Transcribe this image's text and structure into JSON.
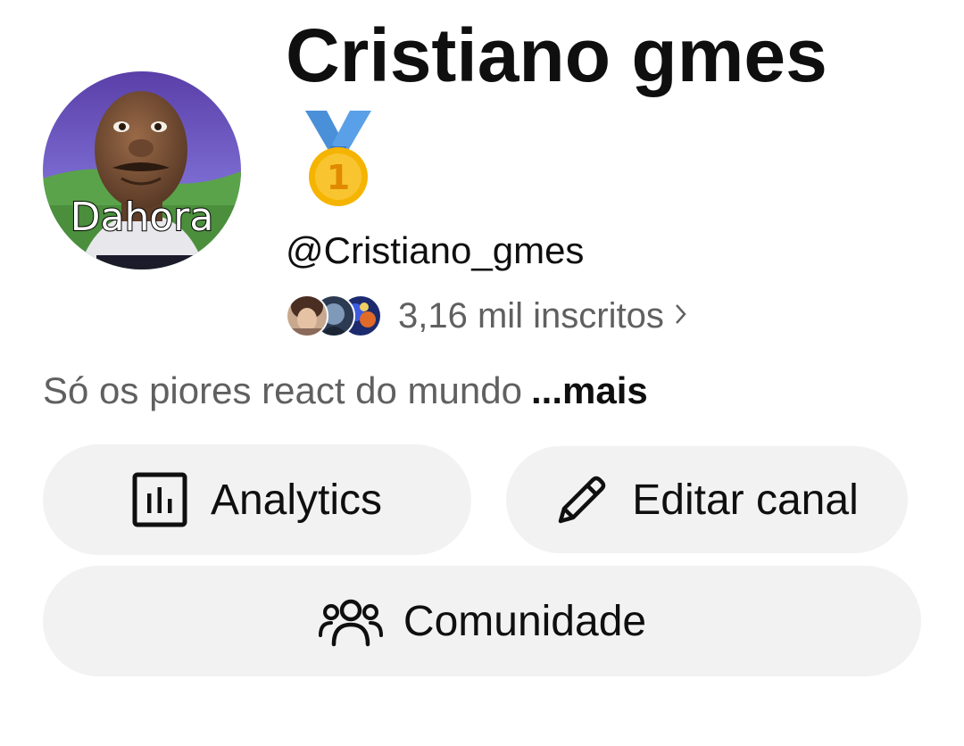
{
  "channel": {
    "name": "Cristiano gmes",
    "handle": "@Cristiano_gmes",
    "avatar_caption": "Dahora",
    "badge_icon": "first-place-medal-icon",
    "subscribers": "3,16 mil inscritos",
    "description": "Só os piores react do mundo",
    "more_label": "...mais"
  },
  "actions": {
    "analytics_label": "Analytics",
    "analytics_icon": "analytics-chart-icon",
    "edit_label": "Editar canal",
    "edit_icon": "pencil-icon",
    "community_label": "Comunidade",
    "community_icon": "people-group-icon"
  },
  "colors": {
    "text_primary": "#0f0f0f",
    "text_secondary": "#606060",
    "button_bg": "#f2f2f2",
    "medal_gold": "#f5b400",
    "ribbon_blue": "#4a90d9"
  }
}
